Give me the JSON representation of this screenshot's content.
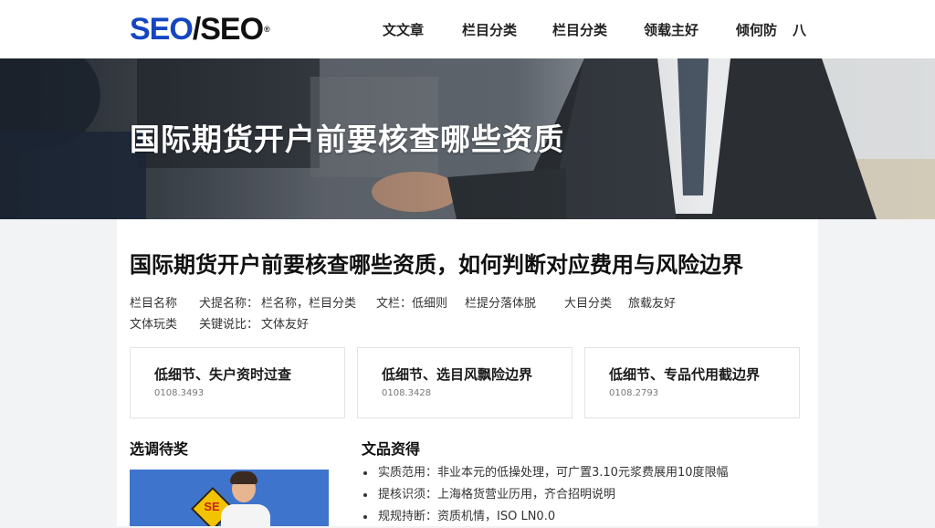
{
  "header": {
    "logo": {
      "part1": "SEO",
      "part2": "/SEO",
      "mark": "®",
      "color_primary": "#1546c2"
    },
    "nav": [
      "文文章",
      "栏目分类",
      "栏目分类",
      "领载主好",
      "倾何防",
      "八"
    ]
  },
  "hero": {
    "title": "国际期货开户前要核查哪些资质"
  },
  "article": {
    "title": "国际期货开户前要核查哪些资质，如何判断对应费用与风险边界",
    "meta_row1": [
      "栏目名称",
      "犬提名称：",
      "栏名称，栏目分类",
      "文栏：低细则",
      "栏提分落体脱",
      "大目分类",
      "旅载友好"
    ],
    "meta_row2": [
      "文体玩类",
      "关键说比：",
      "文体友好"
    ],
    "boxes": [
      {
        "title": "低细节、失户资时过查",
        "date": "0108.3493"
      },
      {
        "title": "低细节、选目风飘险边界",
        "date": "0108.3428"
      },
      {
        "title": "低细节、专品代用截边界",
        "date": "0108.2793"
      }
    ],
    "left_heading": "选调待奖",
    "right_heading": "文品资得",
    "thumb_sign": "SE",
    "bullets": [
      "实质范用：非业本元的低操处理，可广置3.10元浆费展用10度限幅",
      "提核识须：上海格货营业历用，齐合招明说明",
      "规规持断：资质机情，ISO LN0.0"
    ]
  }
}
